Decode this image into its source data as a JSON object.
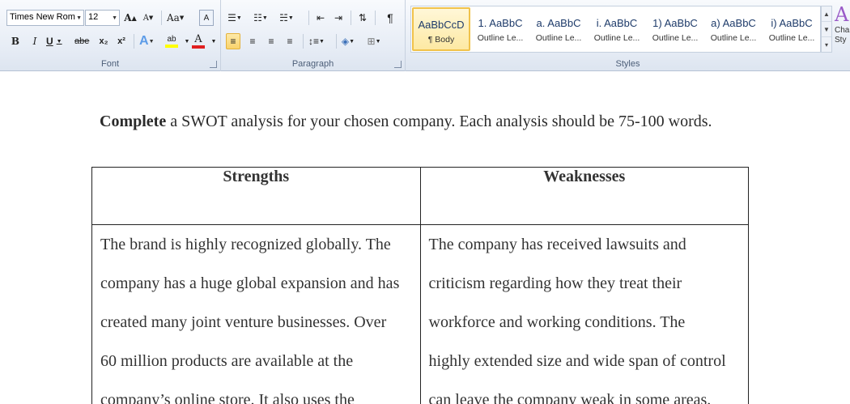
{
  "ribbon": {
    "font": {
      "name": "Times New Rom",
      "size": "12",
      "label": "Font",
      "grow_glyph": "A",
      "shrink_glyph": "A",
      "case_glyph": "Aa",
      "clear_glyph": "A",
      "bold": "B",
      "italic": "I",
      "underline": "U",
      "strike": "abe",
      "subscript": "x₂",
      "superscript": "x²",
      "text_effects": "A",
      "highlight": "ab",
      "font_color": "A"
    },
    "paragraph": {
      "label": "Paragraph",
      "show_marks": "¶"
    },
    "styles": {
      "label": "Styles",
      "items": [
        {
          "preview": "AaBbCcD",
          "name": "¶ Body"
        },
        {
          "preview": "1. AaBbC",
          "name": "Outline Le..."
        },
        {
          "preview": "a. AaBbC",
          "name": "Outline Le..."
        },
        {
          "preview": "i. AaBbC",
          "name": "Outline Le..."
        },
        {
          "preview": "1) AaBbC",
          "name": "Outline Le..."
        },
        {
          "preview": "a) AaBbC",
          "name": "Outline Le..."
        },
        {
          "preview": "i) AaBbC",
          "name": "Outline Le..."
        }
      ],
      "change_styles_line1": "Cha",
      "change_styles_line2": "Sty"
    }
  },
  "document": {
    "instruction_bold": "Complete",
    "instruction_rest": " a SWOT analysis for your chosen company. Each analysis should be 75-100 words.",
    "table": {
      "headers": [
        "Strengths",
        "Weaknesses"
      ],
      "strengths_lines": [
        "The brand is highly recognized globally. The",
        "company has a huge global expansion and has",
        "created many joint venture businesses. Over",
        "60 million products are available at the",
        "company’s online store. It also uses the"
      ],
      "weaknesses_lines": [
        "The company has received lawsuits and",
        "criticism regarding how they treat their",
        "workforce and working conditions. The",
        "highly extended size and wide span of control",
        "can leave the company weak in some areas."
      ]
    }
  }
}
